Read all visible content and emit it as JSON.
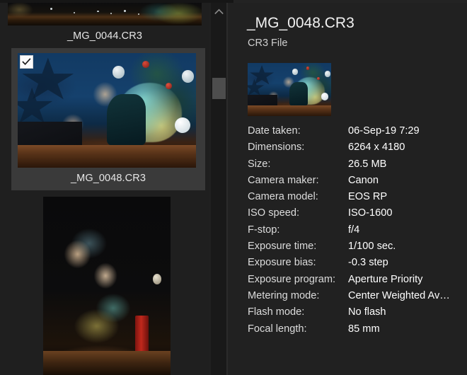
{
  "window": {
    "pane_background": "#202020",
    "list_background": "#1f1f1f",
    "selection_background": "#3a3a3a"
  },
  "file_list": {
    "scrollbar": {
      "up_arrow_icon": "chevron-up-icon",
      "thumb_position_percent": 20
    },
    "items": [
      {
        "filename": "_MG_0044.CR3",
        "selected": false,
        "checked": false,
        "thumbnail_description": "dark photo fragment, wooden bench edge with teal and yellow tulle at right"
      },
      {
        "filename": "_MG_0048.CR3",
        "selected": true,
        "checked": true,
        "check_icon": "checkmark-icon",
        "thumbnail_description": "two girls leaning on wooden bench, blue backdrop with stars and Christmas tree"
      },
      {
        "filename": "",
        "selected": false,
        "checked": false,
        "thumbnail_description": "two girls in teal and yellow tutus sitting on dark wooden bench with red candle"
      }
    ]
  },
  "details": {
    "title": "_MG_0048.CR3",
    "file_type": "CR3 File",
    "preview_description": "thumbnail preview of two girls on wooden bench with blue backdrop",
    "properties": [
      {
        "label": "Date taken:",
        "value": "06-Sep-19 7:29"
      },
      {
        "label": "Dimensions:",
        "value": "6264 x 4180"
      },
      {
        "label": "Size:",
        "value": "26.5 MB"
      },
      {
        "label": "Camera maker:",
        "value": "Canon"
      },
      {
        "label": "Camera model:",
        "value": "EOS RP"
      },
      {
        "label": "ISO speed:",
        "value": "ISO-1600"
      },
      {
        "label": "F-stop:",
        "value": "f/4"
      },
      {
        "label": "Exposure time:",
        "value": "1/100 sec."
      },
      {
        "label": "Exposure bias:",
        "value": "-0.3 step"
      },
      {
        "label": "Exposure program:",
        "value": "Aperture Priority"
      },
      {
        "label": "Metering mode:",
        "value": "Center Weighted Av…"
      },
      {
        "label": "Flash mode:",
        "value": "No flash"
      },
      {
        "label": "Focal length:",
        "value": "85 mm"
      }
    ]
  }
}
